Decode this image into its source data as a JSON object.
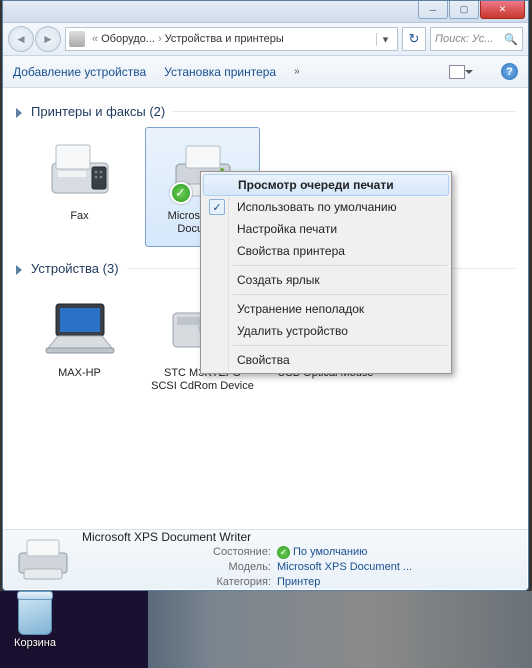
{
  "titlebar": {
    "min": "─",
    "max": "▢",
    "close": "✕"
  },
  "address": {
    "seg1": "Оборудо...",
    "seg2": "Устройства и принтеры",
    "search_placeholder": "Поиск: Ус..."
  },
  "cmdbar": {
    "add_device": "Добавление устройства",
    "install_printer": "Установка принтера",
    "chevron": "»",
    "help": "?"
  },
  "groups": {
    "printers": {
      "title": "Принтеры и факсы",
      "count": "(2)"
    },
    "devices": {
      "title": "Устройства",
      "count": "(3)"
    }
  },
  "items": {
    "fax": "Fax",
    "xps": "Microsoft XPS Docume...",
    "laptop": "MAX-HP",
    "cdrom": "STC M3KTEFG SCSI CdRom Device",
    "mouse": "USB Optical Mouse"
  },
  "context_menu": {
    "open_queue": "Просмотр очереди печати",
    "set_default": "Использовать по умолчанию",
    "print_setup": "Настройка печати",
    "printer_props": "Свойства принтера",
    "create_shortcut": "Создать ярлык",
    "troubleshoot": "Устранение неполадок",
    "remove": "Удалить устройство",
    "properties": "Свойства"
  },
  "details": {
    "title": "Microsoft XPS Document Writer",
    "keys": {
      "state": "Состояние:",
      "model": "Модель:",
      "category": "Категория:"
    },
    "vals": {
      "state": "По умолчанию",
      "model": "Microsoft XPS Document ...",
      "category": "Принтер"
    }
  },
  "desktop": {
    "recycle": "Корзина"
  }
}
